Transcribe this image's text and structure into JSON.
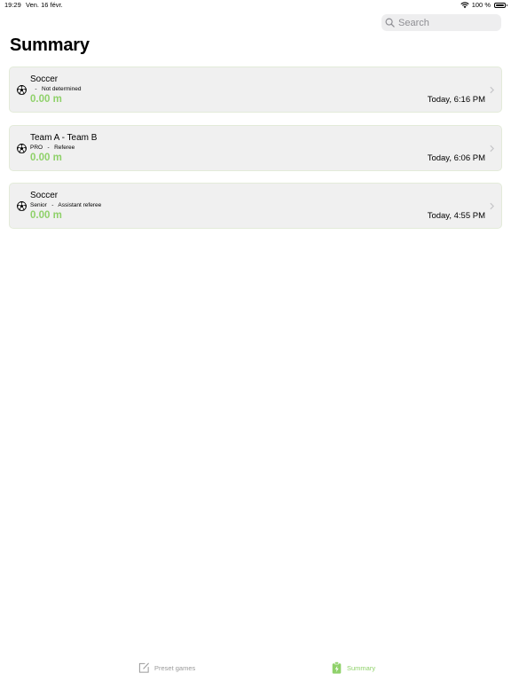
{
  "status_bar": {
    "time": "19:29",
    "date": "Ven. 16 févr.",
    "battery": "100 %"
  },
  "search": {
    "placeholder": "Search",
    "value": ""
  },
  "page_title": "Summary",
  "colors": {
    "accent": "#8fd16a",
    "card_bg": "#f0f0f0",
    "card_border": "#e3ebd9",
    "tab_inactive": "#9a9a9a"
  },
  "games": [
    {
      "icon": "soccer-ball-icon",
      "title": "Soccer",
      "subtitle": "   -   Not determined",
      "distance": "0.00 m",
      "time": "Today, 6:16 PM"
    },
    {
      "icon": "soccer-ball-icon",
      "title": "Team A - Team B",
      "subtitle": "PRO   -   Referee",
      "distance": "0.00 m",
      "time": "Today, 6:06 PM"
    },
    {
      "icon": "soccer-ball-icon",
      "title": "Soccer",
      "subtitle": "Senior   -   Assistant referee",
      "distance": "0.00 m",
      "time": "Today, 4:55 PM"
    }
  ],
  "tabs": [
    {
      "label": "Preset games",
      "icon": "edit-square-icon",
      "selected": false
    },
    {
      "label": "Summary",
      "icon": "clipboard-lightning-icon",
      "selected": true
    }
  ]
}
